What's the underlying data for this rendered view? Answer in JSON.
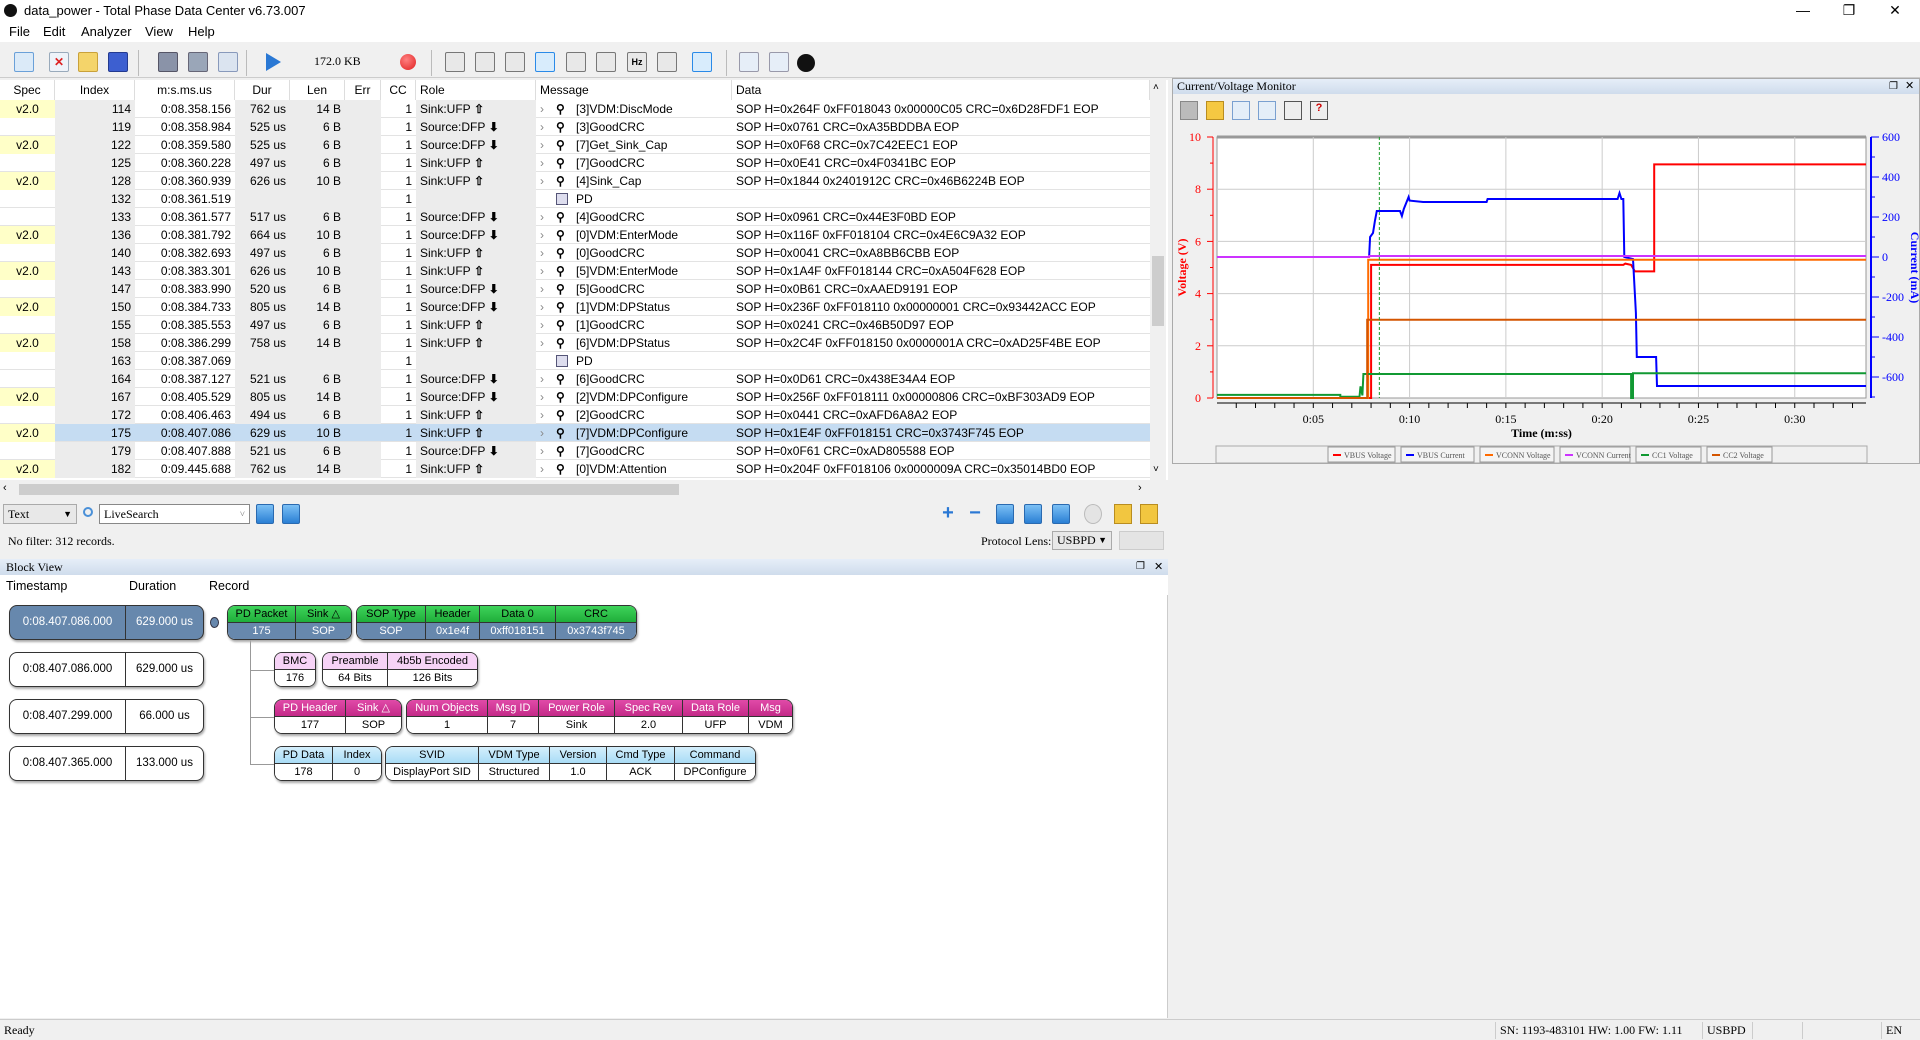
{
  "window": {
    "title": "data_power - Total Phase Data Center v6.73.007",
    "controls": [
      "—",
      "❐",
      "✕"
    ]
  },
  "menu": [
    "File",
    "Edit",
    "Analyzer",
    "View",
    "Help"
  ],
  "toolbar": {
    "capture_size": "172.0 KB",
    "record_color": "#e02020"
  },
  "table": {
    "columns": [
      "Spec",
      "Index",
      "m:s.ms.us",
      "Dur",
      "Len",
      "Err",
      "CC",
      "Role",
      "Message",
      "Data"
    ],
    "selected_index": "175",
    "rows": [
      [
        "v2.0",
        "114",
        "0:08.358.156",
        "762 us",
        "14 B",
        "",
        "1",
        "Sink:UFP",
        "up",
        "[3]VDM:DiscMode",
        "SOP H=0x264F 0xFF018043 0x00000C05 CRC=0x6D28FDF1 EOP"
      ],
      [
        "",
        "119",
        "0:08.358.984",
        "525 us",
        "6 B",
        "",
        "1",
        "Source:DFP",
        "down",
        "[3]GoodCRC",
        "SOP H=0x0761 CRC=0xA35BDDBA EOP"
      ],
      [
        "v2.0",
        "122",
        "0:08.359.580",
        "525 us",
        "6 B",
        "",
        "1",
        "Source:DFP",
        "down",
        "[7]Get_Sink_Cap",
        "SOP H=0x0F68 CRC=0x7C42EEC1 EOP"
      ],
      [
        "",
        "125",
        "0:08.360.228",
        "497 us",
        "6 B",
        "",
        "1",
        "Sink:UFP",
        "up",
        "[7]GoodCRC",
        "SOP H=0x0E41 CRC=0x4F0341BC EOP"
      ],
      [
        "v2.0",
        "128",
        "0:08.360.939",
        "626 us",
        "10 B",
        "",
        "1",
        "Sink:UFP",
        "up",
        "[4]Sink_Cap",
        "SOP H=0x1844 0x2401912C CRC=0x46B6224B EOP"
      ],
      [
        "",
        "132",
        "0:08.361.519",
        "",
        "",
        "",
        "1",
        "",
        "pd",
        "PD",
        ""
      ],
      [
        "",
        "133",
        "0:08.361.577",
        "517 us",
        "6 B",
        "",
        "1",
        "Source:DFP",
        "down",
        "[4]GoodCRC",
        "SOP H=0x0961 CRC=0x44E3F0BD EOP"
      ],
      [
        "v2.0",
        "136",
        "0:08.381.792",
        "664 us",
        "10 B",
        "",
        "1",
        "Source:DFP",
        "down",
        "[0]VDM:EnterMode",
        "SOP H=0x116F 0xFF018104 CRC=0x4E6C9A32 EOP"
      ],
      [
        "",
        "140",
        "0:08.382.693",
        "497 us",
        "6 B",
        "",
        "1",
        "Sink:UFP",
        "up",
        "[0]GoodCRC",
        "SOP H=0x0041 CRC=0xA8BB6CBB EOP"
      ],
      [
        "v2.0",
        "143",
        "0:08.383.301",
        "626 us",
        "10 B",
        "",
        "1",
        "Sink:UFP",
        "up",
        "[5]VDM:EnterMode",
        "SOP H=0x1A4F 0xFF018144 CRC=0xA504F628 EOP"
      ],
      [
        "",
        "147",
        "0:08.383.990",
        "520 us",
        "6 B",
        "",
        "1",
        "Source:DFP",
        "down",
        "[5]GoodCRC",
        "SOP H=0x0B61 CRC=0xAAED9191 EOP"
      ],
      [
        "v2.0",
        "150",
        "0:08.384.733",
        "805 us",
        "14 B",
        "",
        "1",
        "Source:DFP",
        "down",
        "[1]VDM:DPStatus",
        "SOP H=0x236F 0xFF018110 0x00000001 CRC=0x93442ACC EOP"
      ],
      [
        "",
        "155",
        "0:08.385.553",
        "497 us",
        "6 B",
        "",
        "1",
        "Sink:UFP",
        "up",
        "[1]GoodCRC",
        "SOP H=0x0241 CRC=0x46B50D97 EOP"
      ],
      [
        "v2.0",
        "158",
        "0:08.386.299",
        "758 us",
        "14 B",
        "",
        "1",
        "Sink:UFP",
        "up",
        "[6]VDM:DPStatus",
        "SOP H=0x2C4F 0xFF018150 0x0000001A CRC=0xAD25F4BE EOP"
      ],
      [
        "",
        "163",
        "0:08.387.069",
        "",
        "",
        "",
        "1",
        "",
        "pd",
        "PD",
        ""
      ],
      [
        "",
        "164",
        "0:08.387.127",
        "521 us",
        "6 B",
        "",
        "1",
        "Source:DFP",
        "down",
        "[6]GoodCRC",
        "SOP H=0x0D61 CRC=0x438E34A4 EOP"
      ],
      [
        "v2.0",
        "167",
        "0:08.405.529",
        "805 us",
        "14 B",
        "",
        "1",
        "Source:DFP",
        "down",
        "[2]VDM:DPConfigure",
        "SOP H=0x256F 0xFF018111 0x00000806 CRC=0xBF303AD9 EOP"
      ],
      [
        "",
        "172",
        "0:08.406.463",
        "494 us",
        "6 B",
        "",
        "1",
        "Sink:UFP",
        "up",
        "[2]GoodCRC",
        "SOP H=0x0441 CRC=0xAFD6A8A2 EOP"
      ],
      [
        "v2.0",
        "175",
        "0:08.407.086",
        "629 us",
        "10 B",
        "",
        "1",
        "Sink:UFP",
        "up",
        "[7]VDM:DPConfigure",
        "SOP H=0x1E4F 0xFF018151 CRC=0x3743F745 EOP"
      ],
      [
        "",
        "179",
        "0:08.407.888",
        "521 us",
        "6 B",
        "",
        "1",
        "Source:DFP",
        "down",
        "[7]GoodCRC",
        "SOP H=0x0F61 CRC=0xAD805588 EOP"
      ],
      [
        "v2.0",
        "182",
        "0:09.445.688",
        "762 us",
        "14 B",
        "",
        "1",
        "Sink:UFP",
        "up",
        "[0]VDM:Attention",
        "SOP H=0x204F 0xFF018106 0x0000009A CRC=0x35014BD0 EOP"
      ]
    ]
  },
  "filter": {
    "mode": "Text",
    "search_value": "LiveSearch",
    "status": "No filter: 312 records.",
    "protocol_lens_label": "Protocol Lens:",
    "protocol_lens": "USBPD"
  },
  "block_view": {
    "title": "Block View",
    "columns": [
      "Timestamp",
      "Duration",
      "Record"
    ],
    "timestamps": [
      {
        "ts": "0:08.407.086.000",
        "dur": "629.000 us",
        "selected": true
      },
      {
        "ts": "0:08.407.086.000",
        "dur": "629.000 us"
      },
      {
        "ts": "0:08.407.299.000",
        "dur": "66.000 us"
      },
      {
        "ts": "0:08.407.365.000",
        "dur": "133.000 us"
      }
    ],
    "records": [
      {
        "style": "green",
        "groups": [
          [
            {
              "h": "PD Packet",
              "v": "175"
            },
            {
              "h": "Sink △",
              "v": "SOP"
            }
          ],
          [
            {
              "h": "SOP Type",
              "v": "SOP"
            },
            {
              "h": "Header",
              "v": "0x1e4f"
            },
            {
              "h": "Data 0",
              "v": "0xff018151"
            },
            {
              "h": "CRC",
              "v": "0x3743f745"
            }
          ]
        ]
      },
      {
        "style": "pink",
        "groups": [
          [
            {
              "h": "BMC",
              "v": "176"
            }
          ],
          [
            {
              "h": "Preamble",
              "v": "64 Bits"
            },
            {
              "h": "4b5b Encoded",
              "v": "126 Bits"
            }
          ]
        ]
      },
      {
        "style": "magenta",
        "groups": [
          [
            {
              "h": "PD Header",
              "v": "177"
            },
            {
              "h": "Sink △",
              "v": "SOP"
            }
          ],
          [
            {
              "h": "Num Objects",
              "v": "1"
            },
            {
              "h": "Msg ID",
              "v": "7"
            },
            {
              "h": "Power Role",
              "v": "Sink"
            },
            {
              "h": "Spec Rev",
              "v": "2.0"
            },
            {
              "h": "Data Role",
              "v": "UFP"
            },
            {
              "h": "Msg",
              "v": "VDM"
            }
          ]
        ]
      },
      {
        "style": "blue",
        "groups": [
          [
            {
              "h": "PD Data",
              "v": "178"
            },
            {
              "h": "Index",
              "v": "0"
            }
          ],
          [
            {
              "h": "SVID",
              "v": "DisplayPort SID"
            },
            {
              "h": "VDM Type",
              "v": "Structured"
            },
            {
              "h": "Version",
              "v": "1.0"
            },
            {
              "h": "Cmd Type",
              "v": "ACK"
            },
            {
              "h": "Command",
              "v": "DPConfigure"
            }
          ]
        ]
      }
    ]
  },
  "monitor": {
    "title": "Current/Voltage Monitor"
  },
  "chart_data": {
    "type": "line",
    "xlabel": "Time (m:ss)",
    "ylabel": "Voltage (V)",
    "y2label": "Current (mA)",
    "xlim": [
      0,
      33.7
    ],
    "ylim": [
      0,
      10
    ],
    "y2lim": [
      -705,
      600
    ],
    "xticks": [
      {
        "v": 5,
        "label": "0:05"
      },
      {
        "v": 10,
        "label": "0:10"
      },
      {
        "v": 15,
        "label": "0:15"
      },
      {
        "v": 20,
        "label": "0:20"
      },
      {
        "v": 25,
        "label": "0:25"
      },
      {
        "v": 30,
        "label": "0:30"
      }
    ],
    "yticks": [
      "0",
      "2",
      "4",
      "6",
      "8",
      "10"
    ],
    "y2ticks": [
      "600",
      "400",
      "200",
      "0",
      "-200",
      "-400",
      "-600"
    ],
    "grid": true,
    "legend": "bottom",
    "cursor_time": 8.43,
    "series": [
      {
        "name": "VBUS Voltage",
        "color": "#ff0000",
        "axis": "left",
        "points": [
          [
            0,
            0
          ],
          [
            8.0,
            0
          ],
          [
            8.0,
            5.1
          ],
          [
            21.1,
            5.1
          ],
          [
            21.2,
            5.15
          ],
          [
            21.5,
            5.1
          ],
          [
            21.7,
            4.85
          ],
          [
            22.7,
            4.85
          ],
          [
            22.7,
            8.95
          ],
          [
            33.7,
            8.95
          ]
        ]
      },
      {
        "name": "VBUS Current",
        "color": "#0000ff",
        "axis": "right",
        "points": [
          [
            7.9,
            0
          ],
          [
            7.95,
            100
          ],
          [
            8.1,
            120
          ],
          [
            8.2,
            180
          ],
          [
            8.3,
            230
          ],
          [
            9.5,
            230
          ],
          [
            9.6,
            205
          ],
          [
            9.7,
            240
          ],
          [
            9.95,
            300
          ],
          [
            10.0,
            282
          ],
          [
            10.7,
            275
          ],
          [
            14.0,
            275
          ],
          [
            14.05,
            290
          ],
          [
            20.8,
            290
          ],
          [
            20.9,
            320
          ],
          [
            21.0,
            290
          ],
          [
            21.1,
            290
          ],
          [
            21.15,
            0
          ],
          [
            21.6,
            -10
          ],
          [
            21.75,
            -280
          ],
          [
            21.8,
            -500
          ],
          [
            22.8,
            -500
          ],
          [
            22.85,
            -645
          ],
          [
            33.7,
            -645
          ]
        ]
      },
      {
        "name": "VCONN Voltage",
        "color": "#ff6a00",
        "axis": "left",
        "points": [
          [
            0,
            0
          ],
          [
            7.85,
            0
          ],
          [
            7.85,
            5.3
          ],
          [
            33.7,
            5.3
          ]
        ]
      },
      {
        "name": "VCONN Current",
        "color": "#cc33ff",
        "axis": "right",
        "points": [
          [
            0,
            0
          ],
          [
            7.9,
            0
          ],
          [
            7.9,
            5
          ],
          [
            33.7,
            5
          ]
        ]
      },
      {
        "name": "CC1 Voltage",
        "color": "#119933",
        "axis": "left",
        "points": [
          [
            0,
            0.12
          ],
          [
            6.4,
            0.12
          ],
          [
            6.4,
            0.05
          ],
          [
            7.4,
            0.05
          ],
          [
            7.45,
            0.45
          ],
          [
            7.55,
            0.1
          ],
          [
            7.6,
            0.92
          ],
          [
            21.5,
            0.92
          ],
          [
            21.5,
            0
          ],
          [
            21.6,
            0
          ],
          [
            21.6,
            0.95
          ],
          [
            33.7,
            0.95
          ]
        ]
      },
      {
        "name": "CC2 Voltage",
        "color": "#d45500",
        "axis": "left",
        "points": [
          [
            0,
            0
          ],
          [
            7.8,
            0
          ],
          [
            7.8,
            3.0
          ],
          [
            33.7,
            3.0
          ]
        ]
      }
    ]
  },
  "status": {
    "ready": "Ready",
    "device": "SN: 1193-483101  HW: 1.00  FW: 1.11",
    "protocol": "USBPD",
    "lang": "EN"
  }
}
